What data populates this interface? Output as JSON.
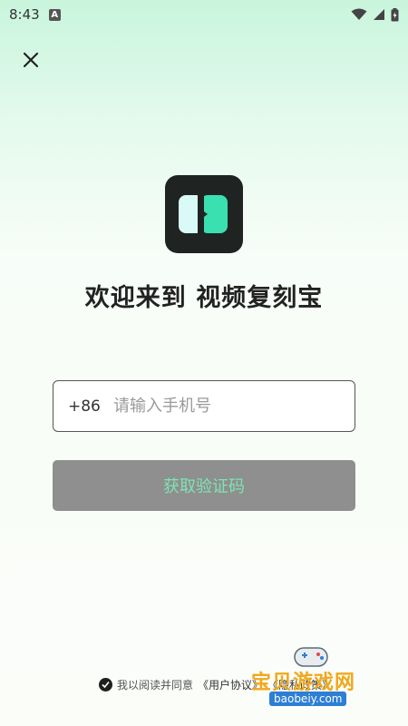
{
  "status_bar": {
    "time": "8:43",
    "badge": "A",
    "icons": [
      "wifi-icon",
      "signal-icon",
      "battery-icon"
    ]
  },
  "close": {
    "icon": "close-icon"
  },
  "logo": {
    "icon": "app-logo",
    "colors": {
      "bg": "#1f2322",
      "left": "#d9faf6",
      "right": "#3ae0b0"
    }
  },
  "welcome": {
    "title": "欢迎来到 视频复刻宝"
  },
  "phone": {
    "country_code": "+86",
    "placeholder": "请输入手机号",
    "value": ""
  },
  "code_button": {
    "label": "获取验证码"
  },
  "agreement": {
    "prefix": "我以阅读并同意",
    "user_agreement": "《用户协议》",
    "privacy_policy": "《隐私政策》"
  },
  "watermark": {
    "text": "宝贝游戏网",
    "url": "baobeiy.com"
  },
  "colors": {
    "accent": "#3ae0b0",
    "button_bg": "#8e8f8e",
    "button_text": "#7ee3b5"
  }
}
